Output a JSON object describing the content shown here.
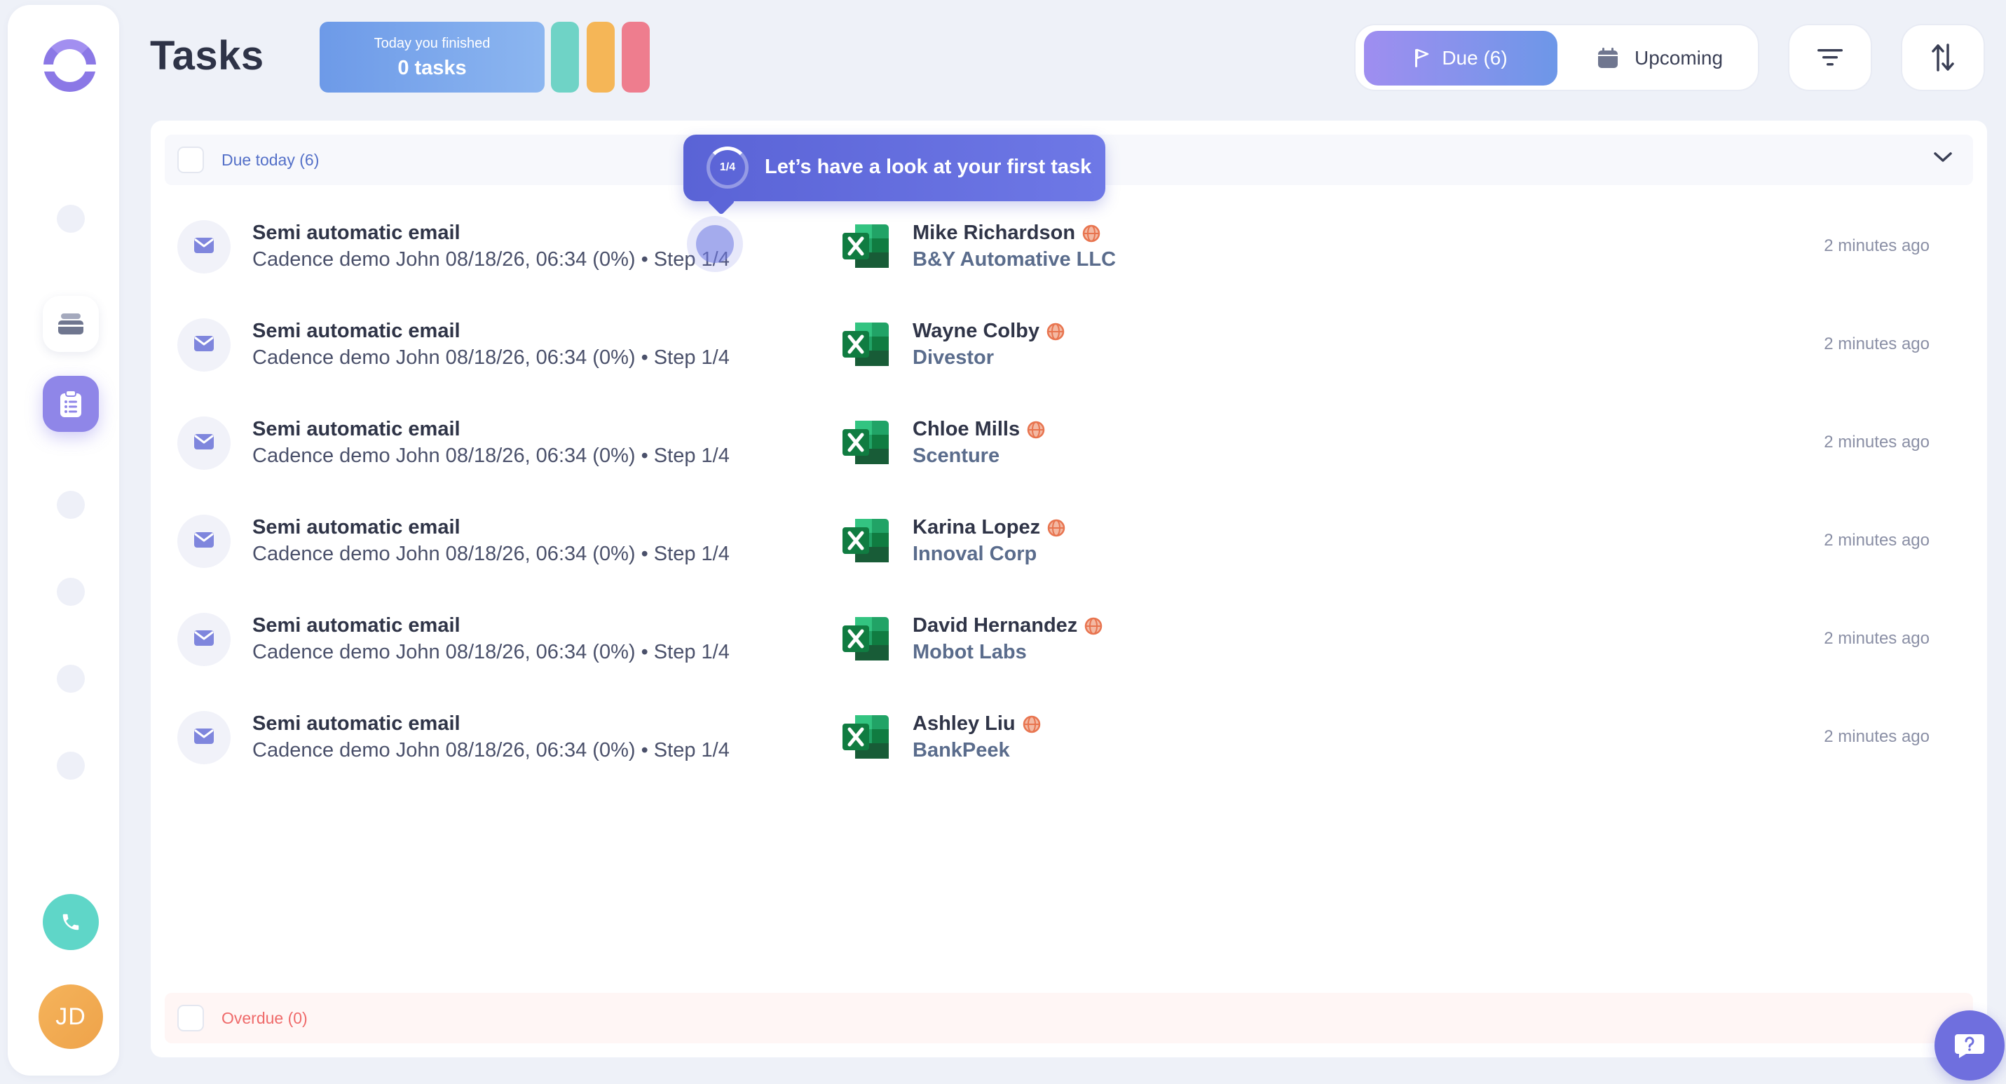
{
  "header": {
    "title": "Tasks",
    "finished_line1": "Today you finished",
    "finished_line2": "0 tasks",
    "pill_colors": [
      "#6fd3c6",
      "#f5b657",
      "#ee7d8e"
    ]
  },
  "tabs": {
    "due_label": "Due (6)",
    "upcoming_label": "Upcoming"
  },
  "sidebar": {
    "avatar_initials": "JD"
  },
  "tooltip": {
    "step": "1/4",
    "text": "Let’s have a look at your first task"
  },
  "groups": {
    "due_label": "Due today (6)",
    "overdue_label": "Overdue (0)"
  },
  "tasks": [
    {
      "title": "Semi automatic email",
      "subtitle": "Cadence demo John 08/18/26, 06:34 (0%) • Step 1/4",
      "person": "Mike Richardson",
      "company": "B&Y Automative LLC",
      "time": "2 minutes ago"
    },
    {
      "title": "Semi automatic email",
      "subtitle": "Cadence demo John 08/18/26, 06:34 (0%) • Step 1/4",
      "person": "Wayne Colby",
      "company": "Divestor",
      "time": "2 minutes ago"
    },
    {
      "title": "Semi automatic email",
      "subtitle": "Cadence demo John 08/18/26, 06:34 (0%) • Step 1/4",
      "person": "Chloe Mills",
      "company": "Scenture",
      "time": "2 minutes ago"
    },
    {
      "title": "Semi automatic email",
      "subtitle": "Cadence demo John 08/18/26, 06:34 (0%) • Step 1/4",
      "person": "Karina Lopez",
      "company": "Innoval Corp",
      "time": "2 minutes ago"
    },
    {
      "title": "Semi automatic email",
      "subtitle": "Cadence demo John 08/18/26, 06:34 (0%) • Step 1/4",
      "person": "David Hernandez",
      "company": "Mobot Labs",
      "time": "2 minutes ago"
    },
    {
      "title": "Semi automatic email",
      "subtitle": "Cadence demo John 08/18/26, 06:34 (0%) • Step 1/4",
      "person": "Ashley Liu",
      "company": "BankPeek",
      "time": "2 minutes ago"
    }
  ],
  "icons": {
    "task_type": "mail-icon",
    "source": "excel-icon",
    "person_badge": "globe-icon",
    "help": "question-icon"
  },
  "colors": {
    "accent": "#8f86e8",
    "due_text": "#5470c8",
    "overdue_text": "#ef6a6a"
  }
}
